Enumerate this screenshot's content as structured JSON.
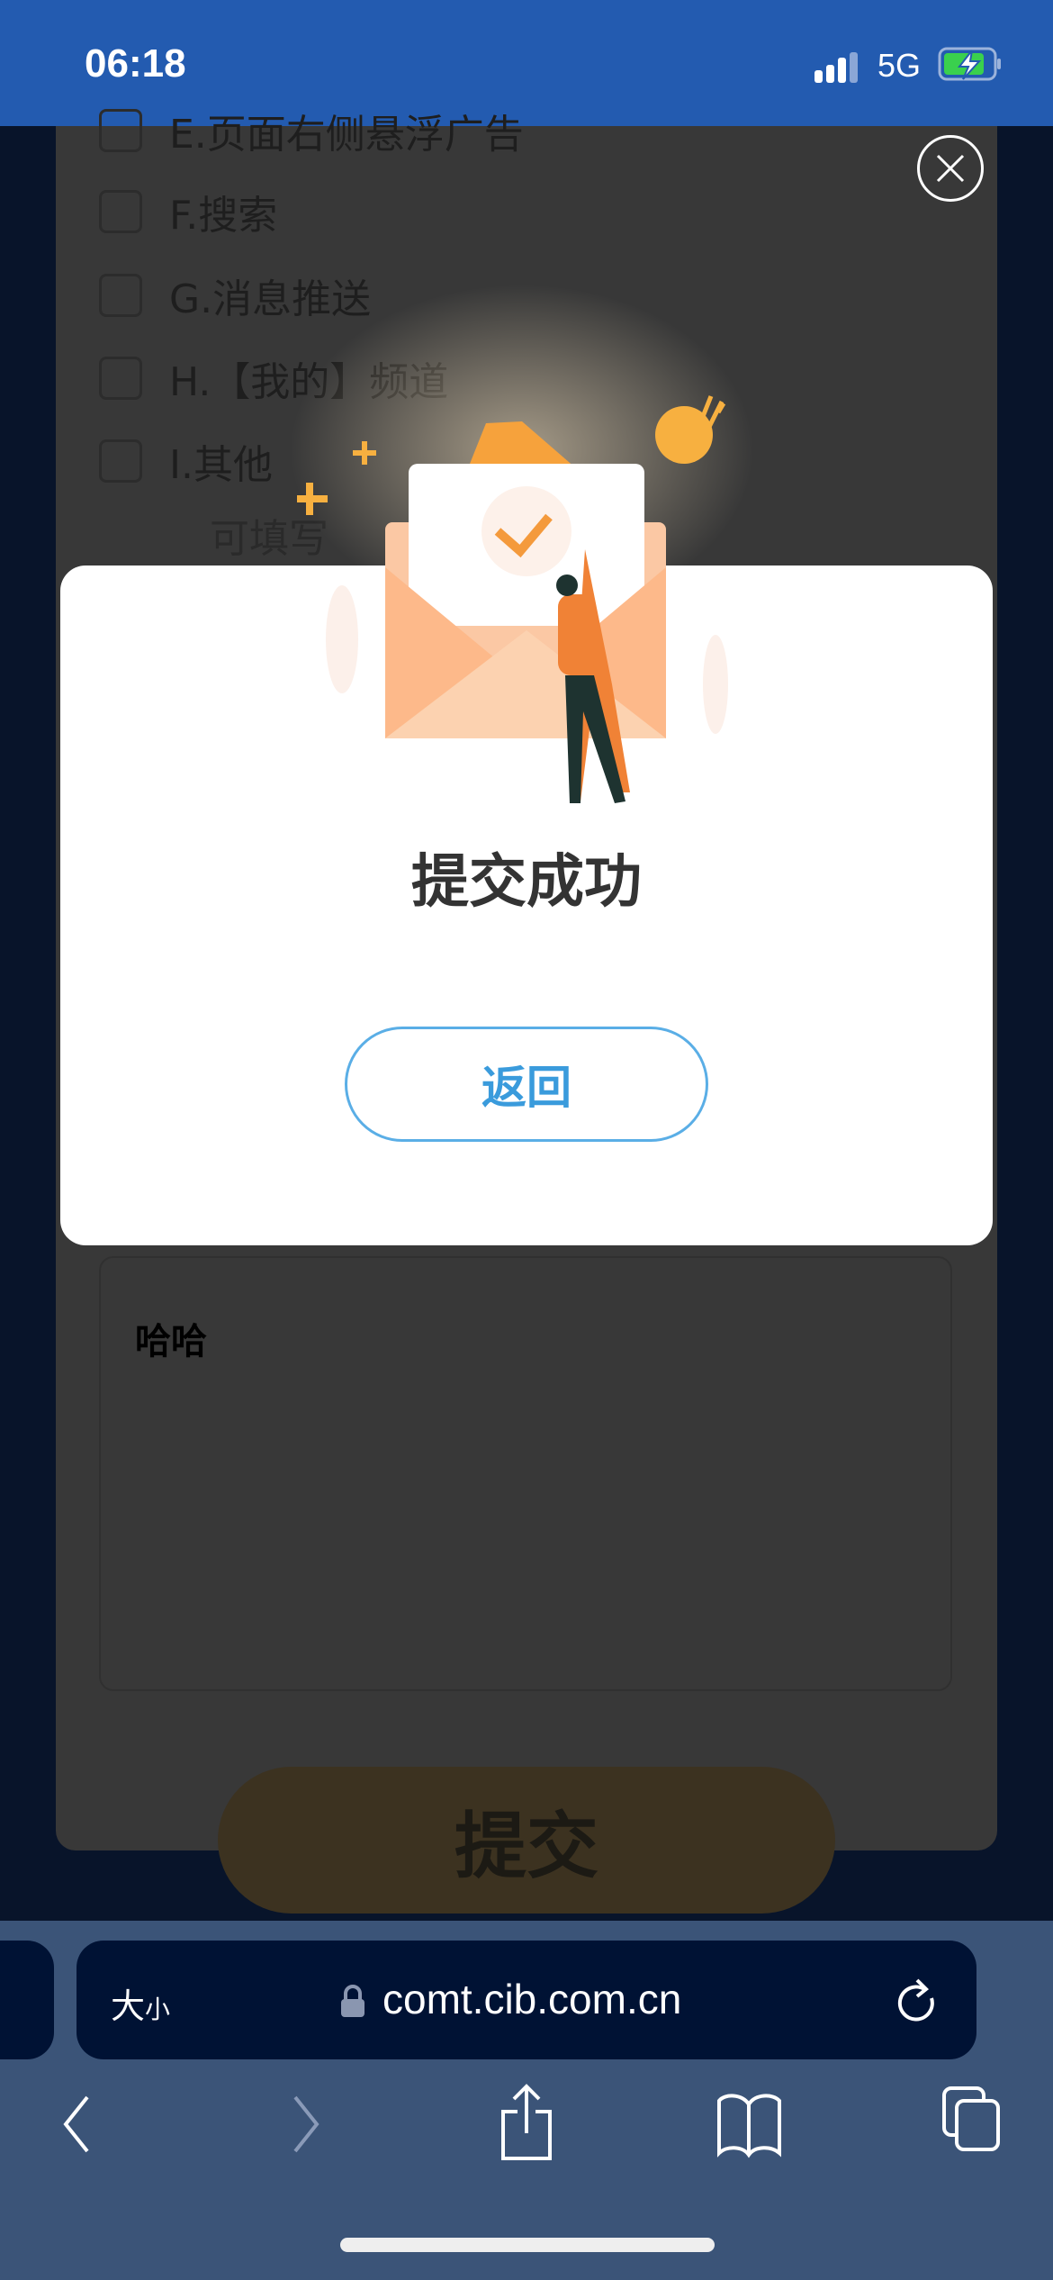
{
  "status_bar": {
    "time": "06:18",
    "network": "5G"
  },
  "survey": {
    "options": [
      {
        "label": "E.页面右侧悬浮广告"
      },
      {
        "label": "F.搜索"
      },
      {
        "label": "G.消息推送"
      },
      {
        "label": "H.【我的】频道"
      },
      {
        "label": "I.其他"
      }
    ],
    "other_placeholder": "可填写",
    "comment_value": "哈哈",
    "submit_label": "提交"
  },
  "modal": {
    "title": "提交成功",
    "return_label": "返回"
  },
  "browser": {
    "text_size_label_big": "大",
    "text_size_label_small": "小",
    "url": "comt.cib.com.cn"
  },
  "colors": {
    "status_bar": "#235bb0",
    "accent": "#3a9bdc",
    "toolbar": "#3b5478",
    "url_bar": "#001234"
  }
}
